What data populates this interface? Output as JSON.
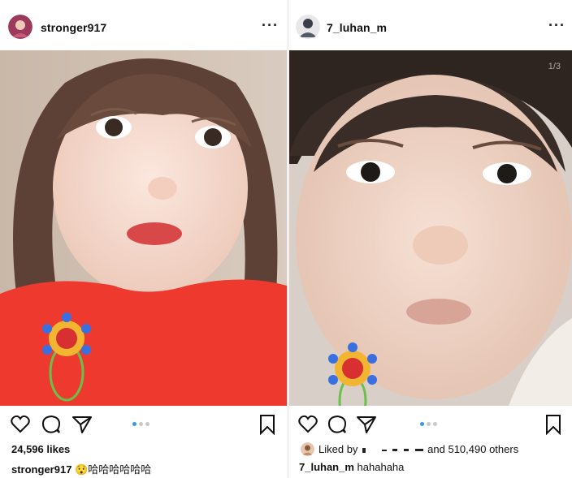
{
  "posts": [
    {
      "username": "stronger917",
      "likes": "24,596 likes",
      "caption_user": "stronger917",
      "caption_emoji": "😯",
      "caption_text": "哈哈哈哈哈哈",
      "carousel_pages": 3,
      "carousel_active": 1,
      "avatar_color": "#9b3a5a"
    },
    {
      "username": "7_luhan_m",
      "photo_counter": "1/3",
      "liked_by_prefix": "Liked by",
      "liked_by_suffix": "and 510,490 others",
      "caption_user": "7_luhan_m",
      "caption_text": "hahahaha",
      "carousel_pages": 3,
      "carousel_active": 1,
      "avatar_color": "#3a3f4a"
    }
  ],
  "icons": [
    "heart-icon",
    "comment-icon",
    "share-icon",
    "bookmark-icon",
    "more-options-icon"
  ],
  "colors": {
    "accent": "#3897f0",
    "shirt_red": "#ee3a2e",
    "text": "#111111"
  }
}
